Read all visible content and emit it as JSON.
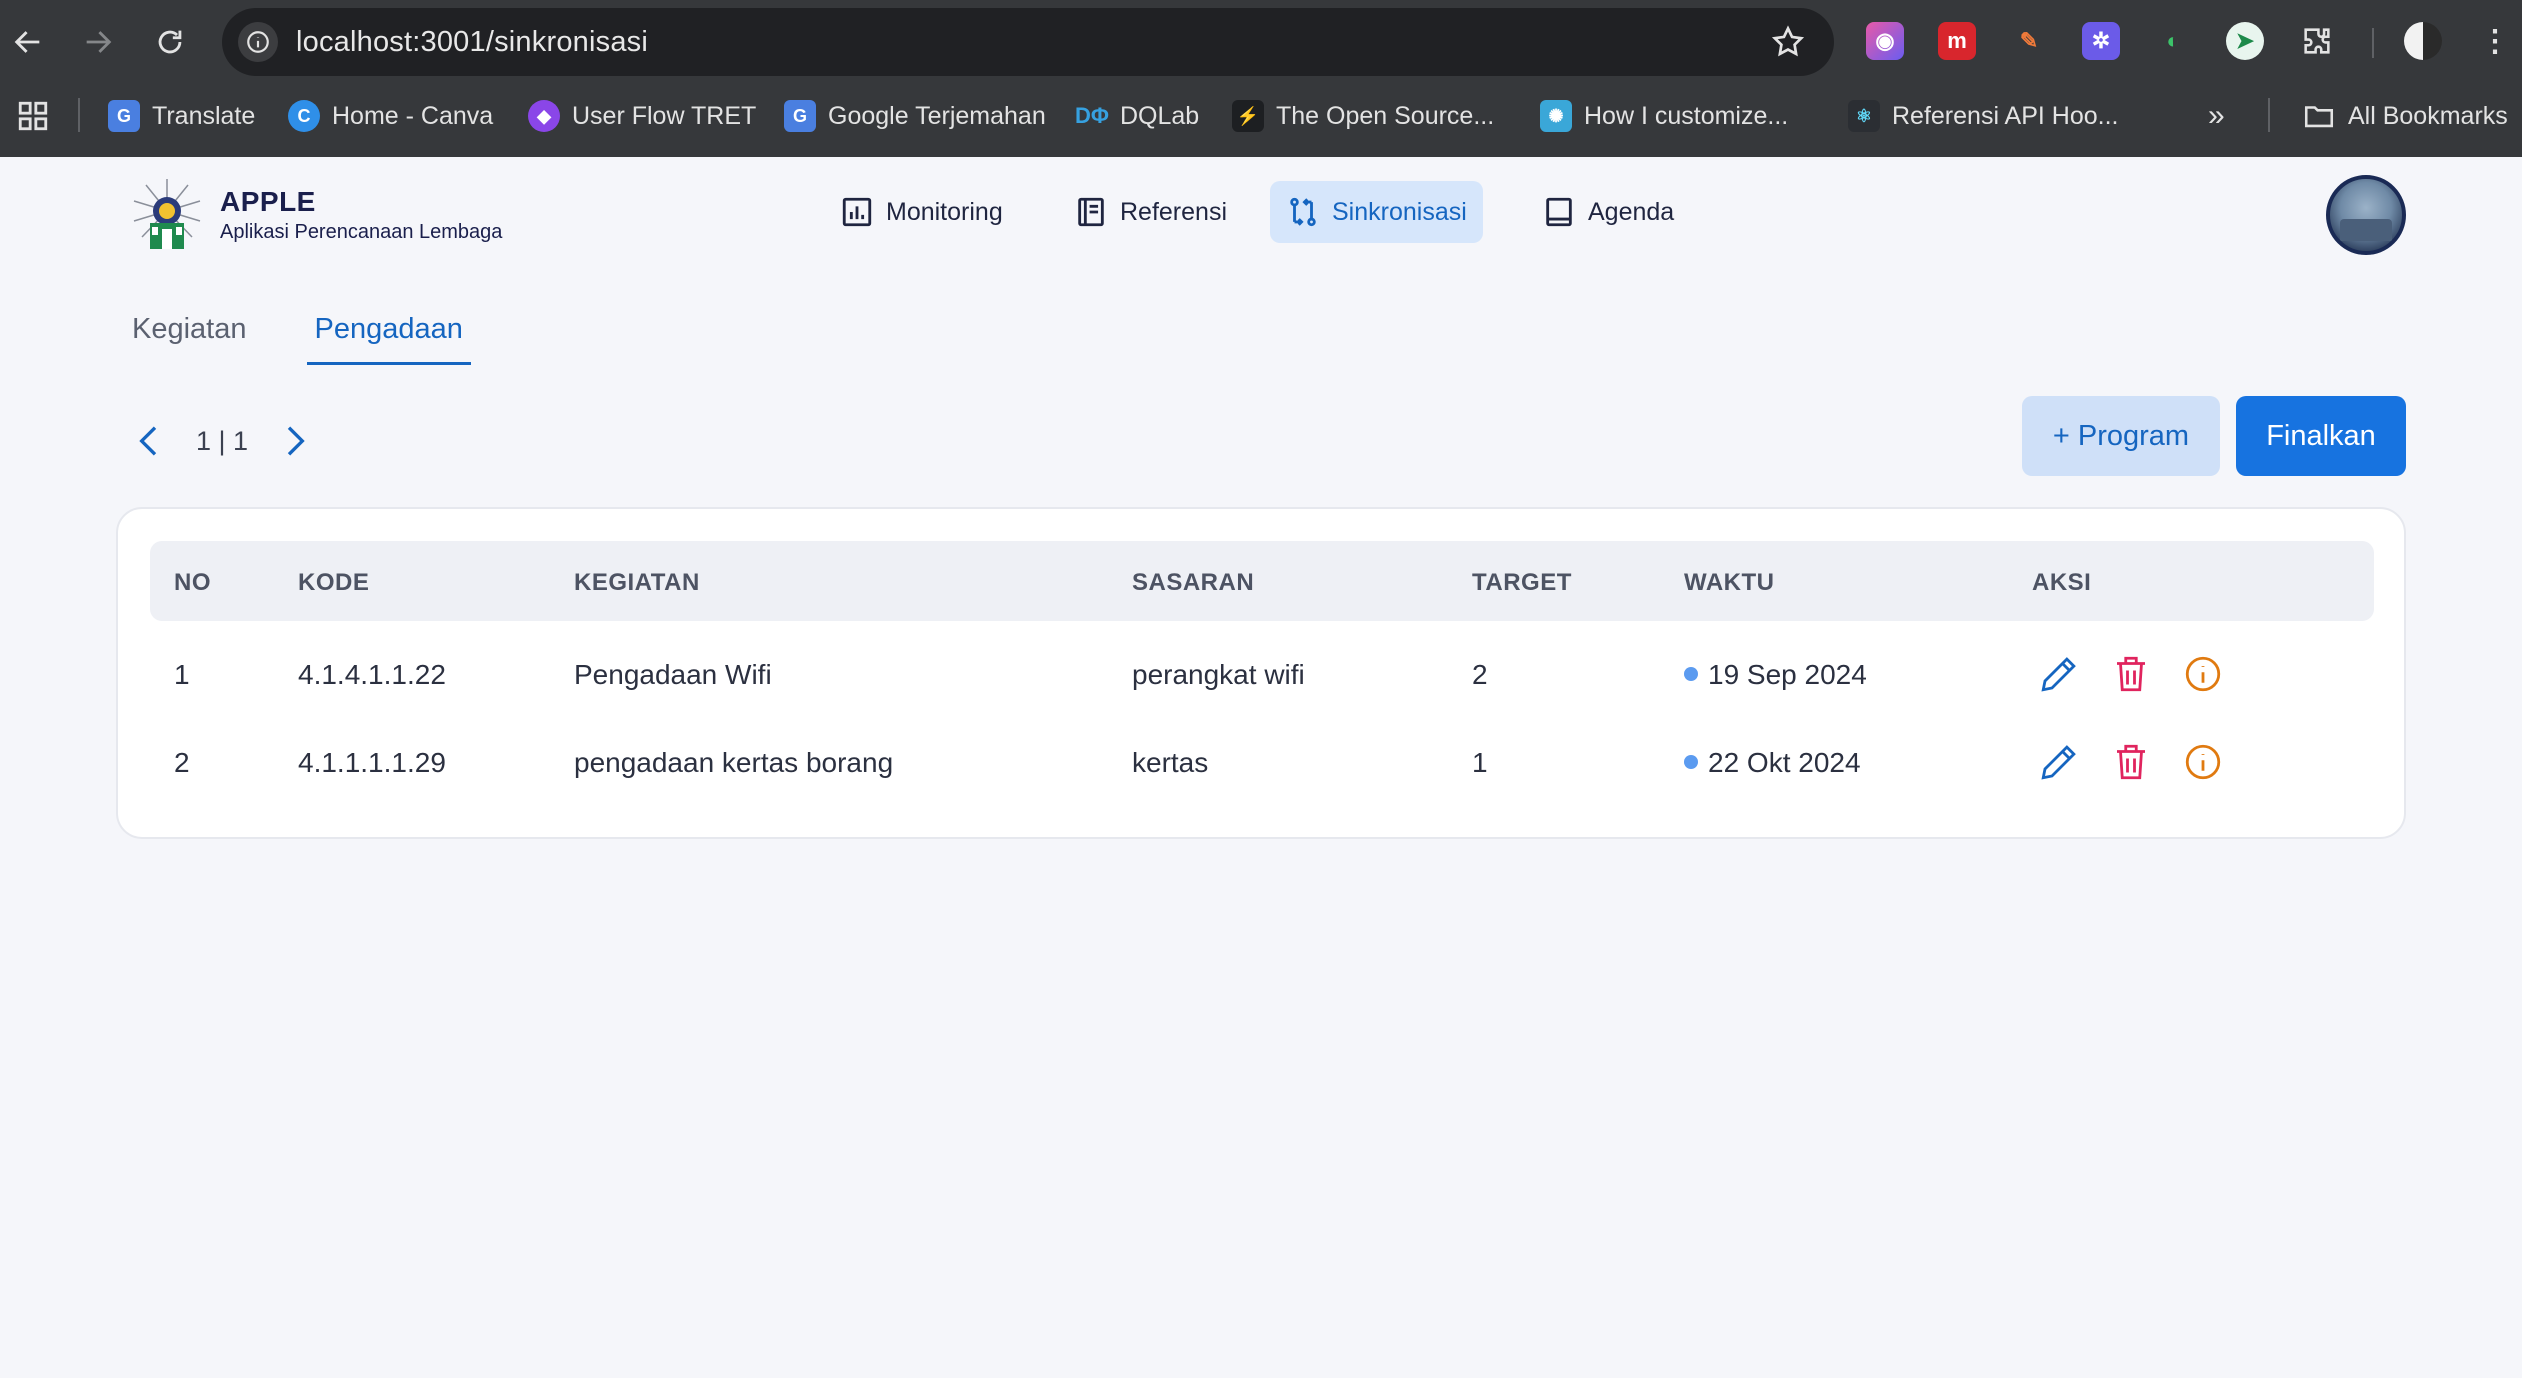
{
  "browser": {
    "url": "localhost:3001/sinkronisasi",
    "bookmarks": [
      {
        "label": "Translate",
        "icon": "google-translate-icon",
        "color": "#4a7fe0"
      },
      {
        "label": "Home - Canva",
        "icon": "canva-icon",
        "color": "#2f8fe8"
      },
      {
        "label": "User Flow TRET",
        "icon": "flow-icon",
        "color": "#8a46e8"
      },
      {
        "label": "Google Terjemahan",
        "icon": "google-translate-icon",
        "color": "#4a7fe0"
      },
      {
        "label": "DQLab",
        "icon": "dqlab-icon",
        "color": "#36a1e0"
      },
      {
        "label": "The Open Source...",
        "icon": "lightning-icon",
        "color": "#1f8f4e"
      },
      {
        "label": "How I customize...",
        "icon": "gear-icon",
        "color": "#3aa7d8"
      },
      {
        "label": "Referensi API Hoo...",
        "icon": "react-icon",
        "color": "#2b2e33"
      }
    ],
    "all_bookmarks_label": "All Bookmarks"
  },
  "brand": {
    "title": "APPLE",
    "subtitle": "Aplikasi Perencanaan Lembaga"
  },
  "menu": [
    {
      "label": "Monitoring",
      "icon": "bar-chart-icon",
      "active": false
    },
    {
      "label": "Referensi",
      "icon": "book-icon",
      "active": false
    },
    {
      "label": "Sinkronisasi",
      "icon": "sync-icon",
      "active": true
    },
    {
      "label": "Agenda",
      "icon": "agenda-icon",
      "active": false
    }
  ],
  "tabs": [
    {
      "label": "Kegiatan",
      "active": false
    },
    {
      "label": "Pengadaan",
      "active": true
    }
  ],
  "pager": {
    "text": "1 | 1"
  },
  "actions": {
    "program_label": "+ Program",
    "finalize_label": "Finalkan"
  },
  "table": {
    "headers": [
      "NO",
      "KODE",
      "KEGIATAN",
      "SASARAN",
      "TARGET",
      "WAKTU",
      "AKSI"
    ],
    "rows": [
      {
        "no": "1",
        "kode": "4.1.4.1.1.22",
        "kegiatan": "Pengadaan Wifi",
        "sasaran": "perangkat wifi",
        "target": "2",
        "waktu": "19 Sep 2024"
      },
      {
        "no": "2",
        "kode": "4.1.1.1.1.29",
        "kegiatan": "pengadaan kertas borang",
        "sasaran": "kertas",
        "target": "1",
        "waktu": "22 Okt 2024"
      }
    ]
  },
  "colors": {
    "primary": "#1773e0",
    "edit": "#1565c0",
    "delete": "#e0245e",
    "info": "#e07a10"
  }
}
